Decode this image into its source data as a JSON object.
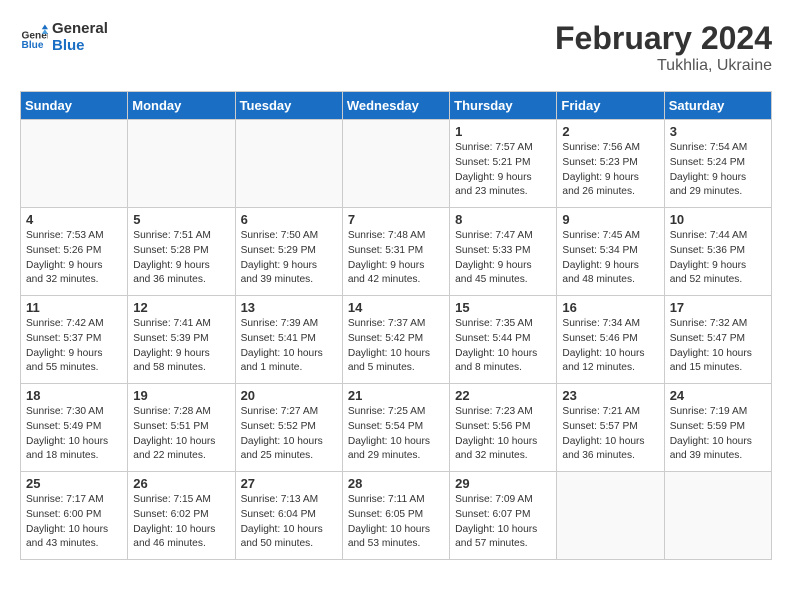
{
  "header": {
    "logo_line1": "General",
    "logo_line2": "Blue",
    "title": "February 2024",
    "subtitle": "Tukhlia, Ukraine"
  },
  "weekdays": [
    "Sunday",
    "Monday",
    "Tuesday",
    "Wednesday",
    "Thursday",
    "Friday",
    "Saturday"
  ],
  "weeks": [
    [
      {
        "num": "",
        "info": ""
      },
      {
        "num": "",
        "info": ""
      },
      {
        "num": "",
        "info": ""
      },
      {
        "num": "",
        "info": ""
      },
      {
        "num": "1",
        "info": "Sunrise: 7:57 AM\nSunset: 5:21 PM\nDaylight: 9 hours\nand 23 minutes."
      },
      {
        "num": "2",
        "info": "Sunrise: 7:56 AM\nSunset: 5:23 PM\nDaylight: 9 hours\nand 26 minutes."
      },
      {
        "num": "3",
        "info": "Sunrise: 7:54 AM\nSunset: 5:24 PM\nDaylight: 9 hours\nand 29 minutes."
      }
    ],
    [
      {
        "num": "4",
        "info": "Sunrise: 7:53 AM\nSunset: 5:26 PM\nDaylight: 9 hours\nand 32 minutes."
      },
      {
        "num": "5",
        "info": "Sunrise: 7:51 AM\nSunset: 5:28 PM\nDaylight: 9 hours\nand 36 minutes."
      },
      {
        "num": "6",
        "info": "Sunrise: 7:50 AM\nSunset: 5:29 PM\nDaylight: 9 hours\nand 39 minutes."
      },
      {
        "num": "7",
        "info": "Sunrise: 7:48 AM\nSunset: 5:31 PM\nDaylight: 9 hours\nand 42 minutes."
      },
      {
        "num": "8",
        "info": "Sunrise: 7:47 AM\nSunset: 5:33 PM\nDaylight: 9 hours\nand 45 minutes."
      },
      {
        "num": "9",
        "info": "Sunrise: 7:45 AM\nSunset: 5:34 PM\nDaylight: 9 hours\nand 48 minutes."
      },
      {
        "num": "10",
        "info": "Sunrise: 7:44 AM\nSunset: 5:36 PM\nDaylight: 9 hours\nand 52 minutes."
      }
    ],
    [
      {
        "num": "11",
        "info": "Sunrise: 7:42 AM\nSunset: 5:37 PM\nDaylight: 9 hours\nand 55 minutes."
      },
      {
        "num": "12",
        "info": "Sunrise: 7:41 AM\nSunset: 5:39 PM\nDaylight: 9 hours\nand 58 minutes."
      },
      {
        "num": "13",
        "info": "Sunrise: 7:39 AM\nSunset: 5:41 PM\nDaylight: 10 hours\nand 1 minute."
      },
      {
        "num": "14",
        "info": "Sunrise: 7:37 AM\nSunset: 5:42 PM\nDaylight: 10 hours\nand 5 minutes."
      },
      {
        "num": "15",
        "info": "Sunrise: 7:35 AM\nSunset: 5:44 PM\nDaylight: 10 hours\nand 8 minutes."
      },
      {
        "num": "16",
        "info": "Sunrise: 7:34 AM\nSunset: 5:46 PM\nDaylight: 10 hours\nand 12 minutes."
      },
      {
        "num": "17",
        "info": "Sunrise: 7:32 AM\nSunset: 5:47 PM\nDaylight: 10 hours\nand 15 minutes."
      }
    ],
    [
      {
        "num": "18",
        "info": "Sunrise: 7:30 AM\nSunset: 5:49 PM\nDaylight: 10 hours\nand 18 minutes."
      },
      {
        "num": "19",
        "info": "Sunrise: 7:28 AM\nSunset: 5:51 PM\nDaylight: 10 hours\nand 22 minutes."
      },
      {
        "num": "20",
        "info": "Sunrise: 7:27 AM\nSunset: 5:52 PM\nDaylight: 10 hours\nand 25 minutes."
      },
      {
        "num": "21",
        "info": "Sunrise: 7:25 AM\nSunset: 5:54 PM\nDaylight: 10 hours\nand 29 minutes."
      },
      {
        "num": "22",
        "info": "Sunrise: 7:23 AM\nSunset: 5:56 PM\nDaylight: 10 hours\nand 32 minutes."
      },
      {
        "num": "23",
        "info": "Sunrise: 7:21 AM\nSunset: 5:57 PM\nDaylight: 10 hours\nand 36 minutes."
      },
      {
        "num": "24",
        "info": "Sunrise: 7:19 AM\nSunset: 5:59 PM\nDaylight: 10 hours\nand 39 minutes."
      }
    ],
    [
      {
        "num": "25",
        "info": "Sunrise: 7:17 AM\nSunset: 6:00 PM\nDaylight: 10 hours\nand 43 minutes."
      },
      {
        "num": "26",
        "info": "Sunrise: 7:15 AM\nSunset: 6:02 PM\nDaylight: 10 hours\nand 46 minutes."
      },
      {
        "num": "27",
        "info": "Sunrise: 7:13 AM\nSunset: 6:04 PM\nDaylight: 10 hours\nand 50 minutes."
      },
      {
        "num": "28",
        "info": "Sunrise: 7:11 AM\nSunset: 6:05 PM\nDaylight: 10 hours\nand 53 minutes."
      },
      {
        "num": "29",
        "info": "Sunrise: 7:09 AM\nSunset: 6:07 PM\nDaylight: 10 hours\nand 57 minutes."
      },
      {
        "num": "",
        "info": ""
      },
      {
        "num": "",
        "info": ""
      }
    ]
  ]
}
